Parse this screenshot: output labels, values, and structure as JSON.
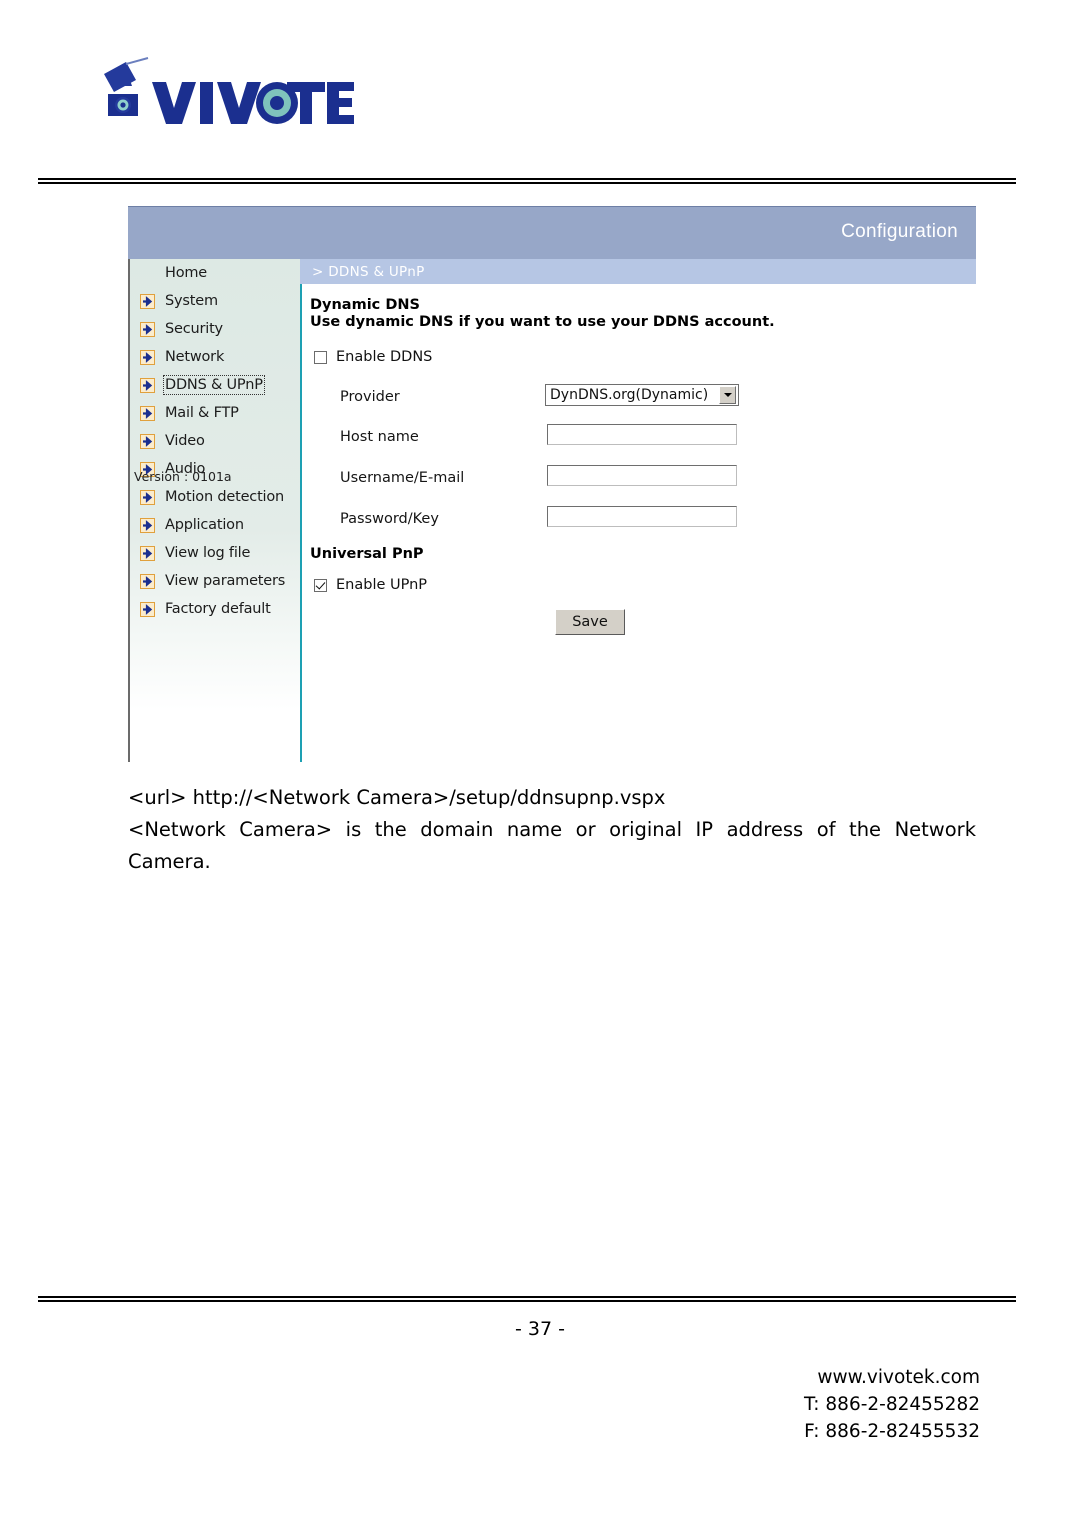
{
  "brand": {
    "logo_text": "VIVOTEK",
    "logo_icon": "vivotek-camera-logo"
  },
  "panel": {
    "header_title": "Configuration",
    "breadcrumb": "> DDNS & UPnP",
    "sidebar": {
      "items": [
        {
          "label": "Home",
          "icon": "none",
          "selected": false
        },
        {
          "label": "System",
          "icon": "arrow-icon",
          "selected": false
        },
        {
          "label": "Security",
          "icon": "arrow-icon",
          "selected": false
        },
        {
          "label": "Network",
          "icon": "arrow-icon",
          "selected": false
        },
        {
          "label": "DDNS & UPnP",
          "icon": "arrow-icon",
          "selected": true
        },
        {
          "label": "Mail & FTP",
          "icon": "arrow-icon",
          "selected": false
        },
        {
          "label": "Video",
          "icon": "arrow-icon",
          "selected": false
        },
        {
          "label": "Audio",
          "icon": "arrow-icon",
          "selected": false
        },
        {
          "label": "Motion detection",
          "icon": "arrow-icon",
          "selected": false
        },
        {
          "label": "Application",
          "icon": "arrow-icon",
          "selected": false
        },
        {
          "label": "View log file",
          "icon": "arrow-icon",
          "selected": false
        },
        {
          "label": "View parameters",
          "icon": "arrow-icon",
          "selected": false
        },
        {
          "label": "Factory default",
          "icon": "arrow-icon",
          "selected": false
        }
      ],
      "version": "Version : 0101a"
    },
    "form": {
      "ddns_section_title": "Dynamic DNS",
      "ddns_section_desc": "Use dynamic DNS if you want to use your DDNS account.",
      "enable_ddns_label": "Enable DDNS",
      "enable_ddns_checked": false,
      "provider_label": "Provider",
      "provider_value": "DynDNS.org(Dynamic)",
      "hostname_label": "Host name",
      "hostname_value": "",
      "username_label": "Username/E-mail",
      "username_value": "",
      "password_label": "Password/Key",
      "password_value": "",
      "upnp_section_title": "Universal PnP",
      "enable_upnp_label": "Enable UPnP",
      "enable_upnp_checked": true,
      "save_label": "Save"
    }
  },
  "document": {
    "url_line": "<url> http://<Network Camera>/setup/ddnsupnp.vspx",
    "description": "<Network Camera> is the domain name or original IP address of the Network Camera.",
    "page_number": "- 37 -",
    "website": "www.vivotek.com",
    "phone": "T: 886-2-82455282",
    "fax": "F: 886-2-82455532"
  },
  "colors": {
    "header_blue": "#97a7c8",
    "breadcrumb_blue": "#b6c6e4",
    "sidebar_mint": "#dde9e4",
    "accent_teal": "#1da0b3",
    "icon_orange": "#e8a33d",
    "icon_blue": "#1b2f8f",
    "logo_navy": "#1b2f8f",
    "logo_teal": "#7fc3bc"
  }
}
